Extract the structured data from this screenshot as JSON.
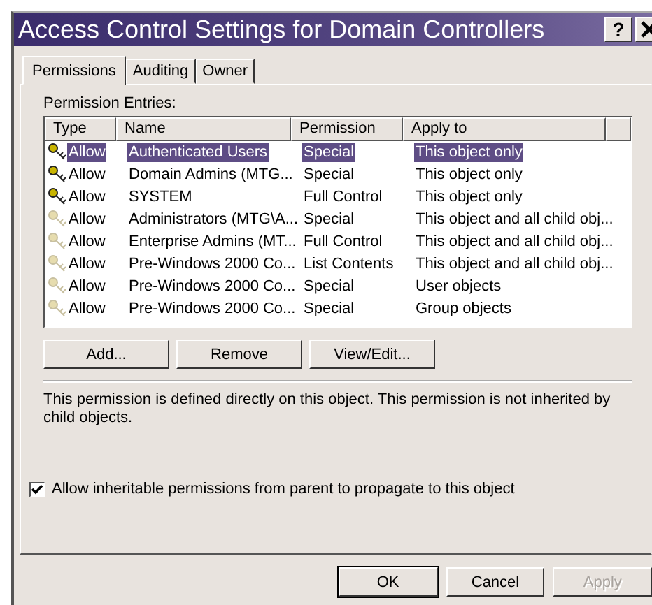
{
  "window": {
    "title": "Access Control Settings for Domain Controllers",
    "help": "?"
  },
  "tabs": [
    {
      "label": "Permissions",
      "selected": true
    },
    {
      "label": "Auditing",
      "selected": false
    },
    {
      "label": "Owner",
      "selected": false
    }
  ],
  "list_label": "Permission Entries:",
  "table": {
    "columns": [
      "Type",
      "Name",
      "Permission",
      "Apply to"
    ],
    "rows": [
      {
        "type": "Allow",
        "name": "Authenticated Users",
        "permission": "Special",
        "apply_to": "This object only",
        "inherited": false,
        "selected": true
      },
      {
        "type": "Allow",
        "name": "Domain Admins (MTG...",
        "permission": "Special",
        "apply_to": "This object only",
        "inherited": false,
        "selected": false
      },
      {
        "type": "Allow",
        "name": "SYSTEM",
        "permission": "Full Control",
        "apply_to": "This object only",
        "inherited": false,
        "selected": false
      },
      {
        "type": "Allow",
        "name": "Administrators (MTG\\A...",
        "permission": "Special",
        "apply_to": "This object and all child obj...",
        "inherited": true,
        "selected": false
      },
      {
        "type": "Allow",
        "name": "Enterprise Admins (MT...",
        "permission": "Full Control",
        "apply_to": "This object and all child obj...",
        "inherited": true,
        "selected": false
      },
      {
        "type": "Allow",
        "name": "Pre-Windows 2000 Co...",
        "permission": "List Contents",
        "apply_to": "This object and all child obj...",
        "inherited": true,
        "selected": false
      },
      {
        "type": "Allow",
        "name": "Pre-Windows 2000 Co...",
        "permission": "Special",
        "apply_to": "User objects",
        "inherited": true,
        "selected": false
      },
      {
        "type": "Allow",
        "name": "Pre-Windows 2000 Co...",
        "permission": "Special",
        "apply_to": "Group objects",
        "inherited": true,
        "selected": false
      }
    ]
  },
  "list_buttons": [
    "Add...",
    "Remove",
    "View/Edit..."
  ],
  "description": "This permission is defined directly on this object. This permission is not inherited by child objects.",
  "inherit_checkbox": {
    "label": "Allow inheritable permissions from parent to propagate to this object",
    "checked": true
  },
  "dialog_buttons": [
    {
      "label": "OK",
      "default": true,
      "disabled": false
    },
    {
      "label": "Cancel",
      "default": false,
      "disabled": false
    },
    {
      "label": "Apply",
      "default": false,
      "disabled": true
    }
  ]
}
